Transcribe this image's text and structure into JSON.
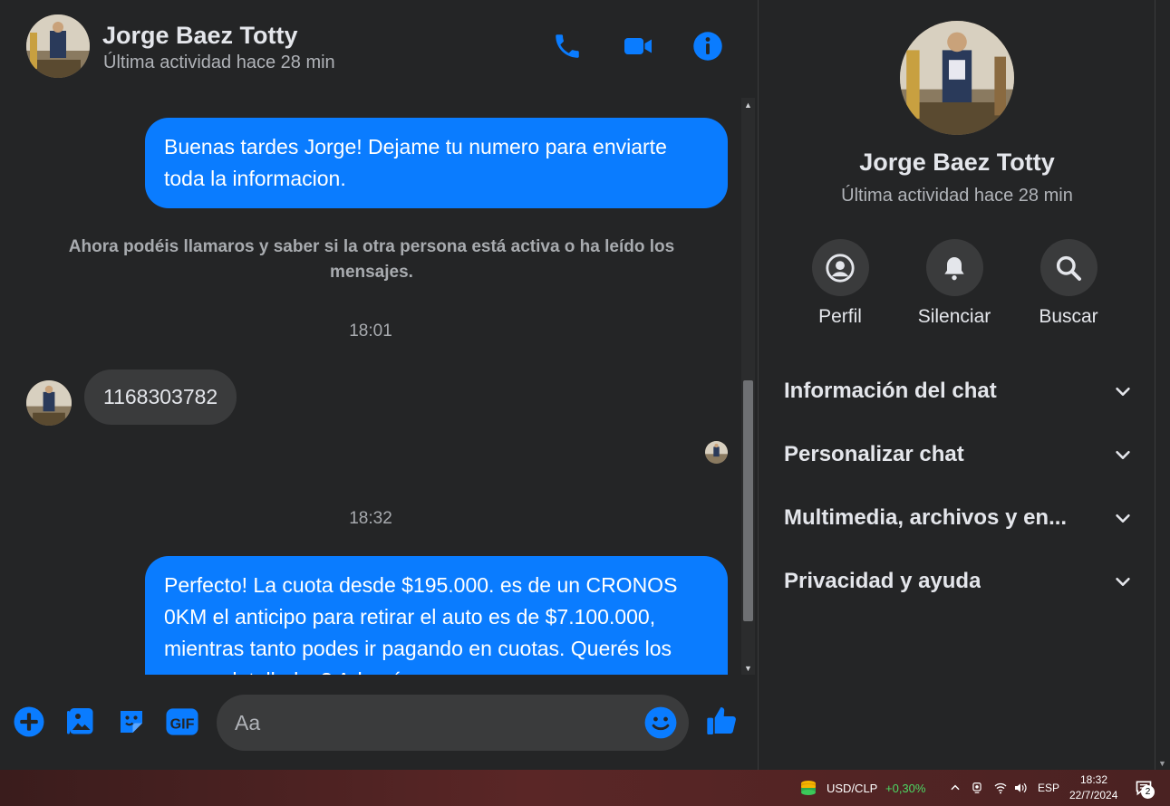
{
  "header": {
    "name": "Jorge Baez Totty",
    "status": "Última actividad hace 28 min"
  },
  "messages": {
    "out1": "Buenas tardes Jorge! Dejame tu numero para enviarte toda la informacion.",
    "system_note": "Ahora podéis llamaros y saber si la otra persona está activa o ha leído los mensajes.",
    "time1": "18:01",
    "in1": "1168303782",
    "time2": "18:32",
    "out2": "Perfecto! La cuota desde $195.000. es de un CRONOS 0KM el anticipo para retirar el auto es de $7.100.000, mientras tanto podes ir pagando en cuotas. Querés los pasos detallados? Además sumamos"
  },
  "composer": {
    "placeholder": "Aa"
  },
  "info": {
    "name": "Jorge Baez Totty",
    "status": "Última actividad hace 28 min",
    "actions": [
      {
        "label": "Perfil",
        "icon": "profile-icon"
      },
      {
        "label": "Silenciar",
        "icon": "bell-icon"
      },
      {
        "label": "Buscar",
        "icon": "search-icon"
      }
    ],
    "sections": [
      {
        "label": "Información del chat"
      },
      {
        "label": "Personalizar chat"
      },
      {
        "label": "Multimedia, archivos y en..."
      },
      {
        "label": "Privacidad y ayuda"
      }
    ]
  },
  "taskbar": {
    "ticker": "USD/CLP",
    "change": "+0,30%",
    "language": "ESP",
    "time": "18:32",
    "date": "22/7/2024",
    "notifications": "2"
  },
  "colors": {
    "accent": "#0a7cff",
    "background": "#242526",
    "bubble_in": "#3a3b3c"
  }
}
